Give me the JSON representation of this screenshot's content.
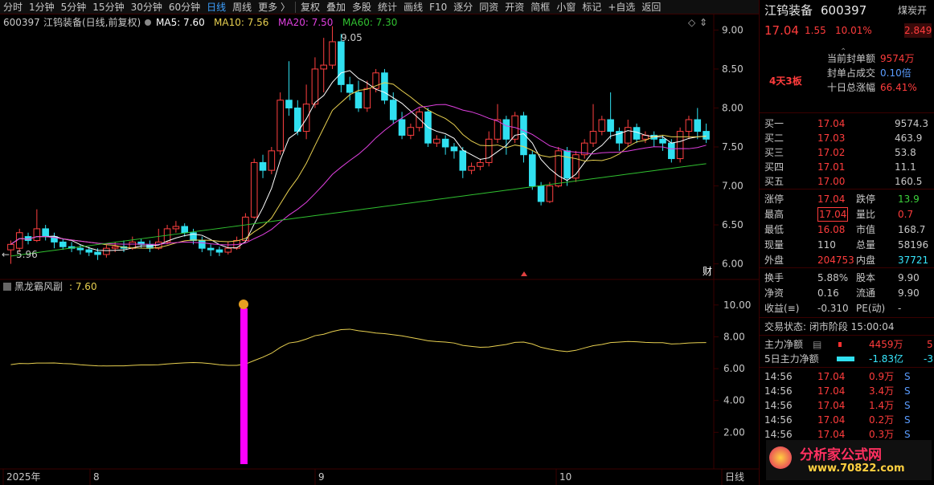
{
  "toolbar": {
    "items": [
      "分时",
      "1分钟",
      "5分钟",
      "15分钟",
      "30分钟",
      "60分钟",
      "日线",
      "周线",
      "更多 〉"
    ],
    "actions": [
      "复权",
      "叠加",
      "多股",
      "统计",
      "画线",
      "F10",
      "逐分",
      "同资",
      "开资",
      "简框",
      "小窗",
      "标记",
      "+自选",
      "返回"
    ]
  },
  "chart": {
    "header_code": "600397",
    "header_name": "江钨装备(日线,前复权)",
    "ma5": "MA5: 7.60",
    "ma10": "MA10: 7.56",
    "ma20": "MA20: 7.50",
    "ma60": "MA60: 7.30",
    "y_ticks": [
      "9.00",
      "8.50",
      "8.00",
      "7.50",
      "7.00",
      "6.50",
      "6.00"
    ],
    "high_marker": "9.05",
    "low_marker": "5.96",
    "cai_label": "财",
    "indicator_name": "黑龙霸风副",
    "indicator_value": ": 7.60",
    "ind_y_ticks": [
      "10.00",
      "8.00",
      "6.00",
      "4.00",
      "2.00"
    ],
    "x_labels": [
      "2025年",
      "8",
      "9",
      "10"
    ],
    "period_label": "日线",
    "colors": {
      "ma5": "#ffffff",
      "ma10": "#e8d050",
      "ma20": "#e040e0",
      "ma60": "#30c030",
      "up": "#ff4040",
      "down": "#30e0f0",
      "signal": "#ff00ff"
    }
  },
  "chart_data": {
    "type": "candlestick",
    "ylim": [
      5.8,
      9.2
    ],
    "candles": [
      [
        6.18,
        6.25,
        6.0,
        6.3
      ],
      [
        6.2,
        6.4,
        6.15,
        6.45
      ],
      [
        6.35,
        6.3,
        6.25,
        6.4
      ],
      [
        6.3,
        6.45,
        6.28,
        6.7
      ],
      [
        6.45,
        6.35,
        6.3,
        6.5
      ],
      [
        6.35,
        6.28,
        6.2,
        6.4
      ],
      [
        6.28,
        6.22,
        6.18,
        6.32
      ],
      [
        6.22,
        6.2,
        6.15,
        6.28
      ],
      [
        6.2,
        6.18,
        6.12,
        6.25
      ],
      [
        6.18,
        6.15,
        6.1,
        6.22
      ],
      [
        6.15,
        6.12,
        6.05,
        6.2
      ],
      [
        6.12,
        6.2,
        6.08,
        6.25
      ],
      [
        6.2,
        6.22,
        6.15,
        6.28
      ],
      [
        6.22,
        6.2,
        6.15,
        6.3
      ],
      [
        6.2,
        6.28,
        6.18,
        6.35
      ],
      [
        6.28,
        6.25,
        6.2,
        6.32
      ],
      [
        6.25,
        6.2,
        6.15,
        6.3
      ],
      [
        6.2,
        6.28,
        6.18,
        6.45
      ],
      [
        6.28,
        6.45,
        6.25,
        6.5
      ],
      [
        6.45,
        6.48,
        6.4,
        6.55
      ],
      [
        6.48,
        6.4,
        6.35,
        6.52
      ],
      [
        6.4,
        6.3,
        6.25,
        6.45
      ],
      [
        6.3,
        6.2,
        6.15,
        6.35
      ],
      [
        6.2,
        6.18,
        6.1,
        6.25
      ],
      [
        6.18,
        6.15,
        6.1,
        6.22
      ],
      [
        6.15,
        6.2,
        6.12,
        6.28
      ],
      [
        6.2,
        6.3,
        6.18,
        6.35
      ],
      [
        6.3,
        6.6,
        6.28,
        6.65
      ],
      [
        6.6,
        7.3,
        6.58,
        7.35
      ],
      [
        7.3,
        7.2,
        7.1,
        7.4
      ],
      [
        7.2,
        7.45,
        7.15,
        7.5
      ],
      [
        7.45,
        8.1,
        7.4,
        8.2
      ],
      [
        8.1,
        8.0,
        7.9,
        8.6
      ],
      [
        8.0,
        7.7,
        7.65,
        8.1
      ],
      [
        7.7,
        8.05,
        7.6,
        8.3
      ],
      [
        8.05,
        8.5,
        8.0,
        8.65
      ],
      [
        8.5,
        8.55,
        8.2,
        8.9
      ],
      [
        8.55,
        8.85,
        8.5,
        9.05
      ],
      [
        8.85,
        8.3,
        8.2,
        8.95
      ],
      [
        8.3,
        8.2,
        8.1,
        8.4
      ],
      [
        8.2,
        8.0,
        7.95,
        8.35
      ],
      [
        8.0,
        8.25,
        7.95,
        8.35
      ],
      [
        8.25,
        8.45,
        8.2,
        8.5
      ],
      [
        8.45,
        8.1,
        8.05,
        8.5
      ],
      [
        8.1,
        7.85,
        7.8,
        8.2
      ],
      [
        7.85,
        7.65,
        7.6,
        7.95
      ],
      [
        7.65,
        7.75,
        7.6,
        7.8
      ],
      [
        7.75,
        7.95,
        7.7,
        8.0
      ],
      [
        7.95,
        7.55,
        7.5,
        8.0
      ],
      [
        7.55,
        7.6,
        7.5,
        7.65
      ],
      [
        7.6,
        7.5,
        7.4,
        7.65
      ],
      [
        7.5,
        7.45,
        7.35,
        7.55
      ],
      [
        7.45,
        7.2,
        7.1,
        7.5
      ],
      [
        7.2,
        7.25,
        7.15,
        7.3
      ],
      [
        7.25,
        7.3,
        7.2,
        7.35
      ],
      [
        7.3,
        7.6,
        7.25,
        7.7
      ],
      [
        7.6,
        7.85,
        7.55,
        8.05
      ],
      [
        7.85,
        7.6,
        7.4,
        7.9
      ],
      [
        7.6,
        7.9,
        7.55,
        7.95
      ],
      [
        7.9,
        7.4,
        7.3,
        7.95
      ],
      [
        7.4,
        7.0,
        6.95,
        7.45
      ],
      [
        7.0,
        6.8,
        6.75,
        7.05
      ],
      [
        6.8,
        7.0,
        6.78,
        7.05
      ],
      [
        7.0,
        7.45,
        6.98,
        7.5
      ],
      [
        7.45,
        7.1,
        7.0,
        7.5
      ],
      [
        7.1,
        7.4,
        7.05,
        7.45
      ],
      [
        7.4,
        7.55,
        7.35,
        7.6
      ],
      [
        7.55,
        7.7,
        7.5,
        8.05
      ],
      [
        7.7,
        7.85,
        7.65,
        7.9
      ],
      [
        7.85,
        7.7,
        7.6,
        8.2
      ],
      [
        7.7,
        7.55,
        7.45,
        7.75
      ],
      [
        7.55,
        7.75,
        7.5,
        7.85
      ],
      [
        7.75,
        7.6,
        7.55,
        7.8
      ],
      [
        7.6,
        7.65,
        7.55,
        7.7
      ],
      [
        7.65,
        7.6,
        7.5,
        7.7
      ],
      [
        7.6,
        7.55,
        7.45,
        7.65
      ],
      [
        7.55,
        7.35,
        7.3,
        7.6
      ],
      [
        7.35,
        7.7,
        7.3,
        7.75
      ],
      [
        7.7,
        7.85,
        7.6,
        7.9
      ],
      [
        7.85,
        7.7,
        7.6,
        8.0
      ],
      [
        7.7,
        7.6,
        7.55,
        7.8
      ]
    ]
  },
  "panel": {
    "name": "江钨装备",
    "code": "600397",
    "tag": "煤炭开",
    "price": "17.04",
    "change": "1.55",
    "pct": "10.01%",
    "side_val": "2.849",
    "board": "4天3板",
    "seal_label": "当前封单额",
    "seal_val": "9574万",
    "seal_ratio_label": "封单占成交",
    "seal_ratio_val": "0.10倍",
    "ten_day_label": "十日总涨幅",
    "ten_day_val": "66.41%",
    "bids": [
      {
        "label": "买一",
        "price": "17.04",
        "vol": "9574.3"
      },
      {
        "label": "买二",
        "price": "17.03",
        "vol": "463.9"
      },
      {
        "label": "买三",
        "price": "17.02",
        "vol": "53.8"
      },
      {
        "label": "买四",
        "price": "17.01",
        "vol": "11.1"
      },
      {
        "label": "买五",
        "price": "17.00",
        "vol": "160.5"
      }
    ],
    "stats": [
      {
        "l1": "涨停",
        "v1": "17.04",
        "l2": "跌停",
        "v2": "13.9"
      },
      {
        "l1": "最高",
        "v1": "17.04",
        "l2": "量比",
        "v2": "0.7"
      },
      {
        "l1": "最低",
        "v1": "16.08",
        "l2": "市值",
        "v2": "168.7"
      },
      {
        "l1": "现量",
        "v1": "110",
        "l2": "总量",
        "v2": "58196"
      },
      {
        "l1": "外盘",
        "v1": "204753",
        "l2": "内盘",
        "v2": "37721"
      }
    ],
    "stats2": [
      {
        "l1": "换手",
        "v1": "5.88%",
        "l2": "股本",
        "v2": "9.90"
      },
      {
        "l1": "净资",
        "v1": "0.16",
        "l2": "流通",
        "v2": "9.90"
      },
      {
        "l1": "收益(≡)",
        "v1": "-0.310",
        "l2": "PE(动)",
        "v2": "-"
      }
    ],
    "trade_status": "交易状态: 闭市阶段 15:00:04",
    "main_net_label": "主力净额",
    "main_net_val": "4459万",
    "main_net_extra": "5",
    "five_day_label": "5日主力净额",
    "five_day_val": "-1.83亿",
    "five_day_extra": "-3",
    "ticks": [
      {
        "t": "14:56",
        "p": "17.04",
        "v": "0.9万",
        "s": "S"
      },
      {
        "t": "14:56",
        "p": "17.04",
        "v": "3.4万",
        "s": "S"
      },
      {
        "t": "14:56",
        "p": "17.04",
        "v": "1.4万",
        "s": "S"
      },
      {
        "t": "14:56",
        "p": "17.04",
        "v": "0.2万",
        "s": "S"
      },
      {
        "t": "14:56",
        "p": "17.04",
        "v": "0.3万",
        "s": "S"
      }
    ],
    "logo_text": "分析家公式网",
    "logo_url": "www.70822.com"
  }
}
